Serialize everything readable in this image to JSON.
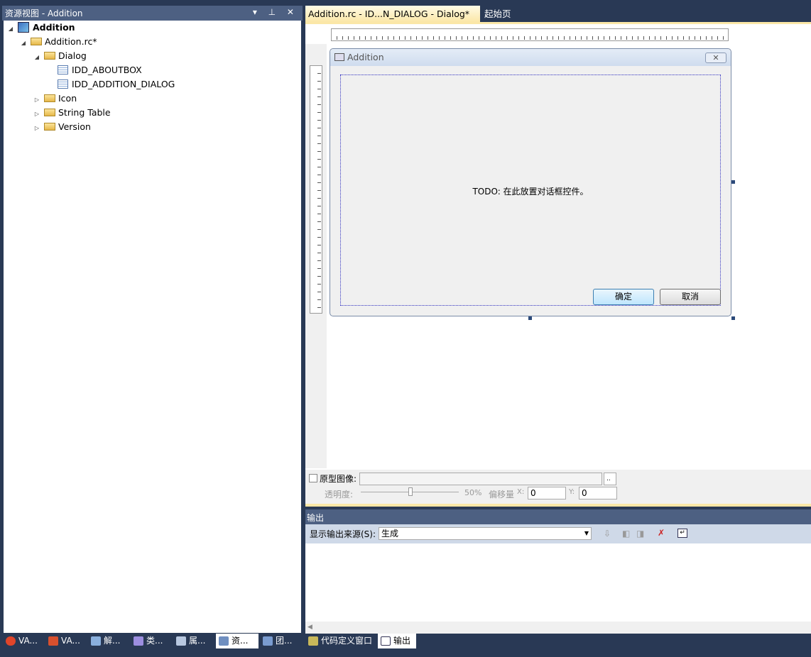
{
  "resource_view": {
    "title": "资源视图 - Addition",
    "controls": "▾ ⊥ ✕",
    "tree": [
      {
        "label": "Addition",
        "bold": true
      },
      {
        "label": "Addition.rc*"
      },
      {
        "label": "Dialog"
      },
      {
        "label": "IDD_ABOUTBOX"
      },
      {
        "label": "IDD_ADDITION_DIALOG"
      },
      {
        "label": "Icon"
      },
      {
        "label": "String Table"
      },
      {
        "label": "Version"
      }
    ]
  },
  "editor": {
    "tabs": [
      {
        "label": "Addition.rc - ID...N_DIALOG - Dialog*",
        "active": true
      },
      {
        "label": "起始页"
      }
    ],
    "close_glyph": "✕",
    "dialog": {
      "title": "Addition",
      "close_glyph": "✕",
      "todo": "TODO: 在此放置对话框控件。",
      "ok": "确定",
      "cancel": "取消"
    }
  },
  "overlay_props": {
    "prototype_label": "原型图像:",
    "browse": "..",
    "opacity_label": "透明度:",
    "opacity_value": "50%",
    "opacity_percent": 50,
    "offset_label": "偏移量",
    "x_label": "X:",
    "x_value": "0",
    "y_label": "Y:",
    "y_value": "0"
  },
  "output": {
    "title": "输出",
    "source_label": "显示输出来源(S):",
    "source_value": "生成"
  },
  "bottom_tabs": [
    {
      "label": "VA...",
      "icon": "tomato-icon"
    },
    {
      "label": "VA...",
      "icon": "tomato-doc-icon"
    },
    {
      "label": "解...",
      "icon": "solution-explorer-icon"
    },
    {
      "label": "类...",
      "icon": "class-view-icon"
    },
    {
      "label": "属...",
      "icon": "property-icon"
    },
    {
      "label": "资...",
      "icon": "resource-view-icon",
      "active": true
    },
    {
      "label": "团...",
      "icon": "team-explorer-icon"
    },
    {
      "label": "代码定义窗口",
      "icon": "code-definition-icon"
    },
    {
      "label": "输出",
      "icon": "output-icon",
      "active": true
    }
  ]
}
